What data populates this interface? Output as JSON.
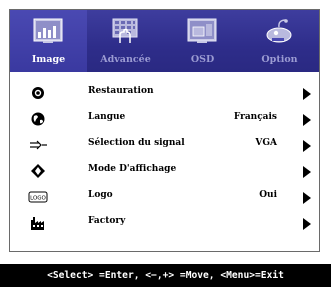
{
  "tabs": [
    {
      "label": "Image",
      "icon": "image-icon",
      "active": true
    },
    {
      "label": "Advancée",
      "icon": "advanced-icon",
      "active": false
    },
    {
      "label": "OSD",
      "icon": "osd-icon",
      "active": false
    },
    {
      "label": "Option",
      "icon": "option-icon",
      "active": false
    }
  ],
  "menu": {
    "items": [
      {
        "label": "Restauration",
        "value": "",
        "icon": "reset-icon"
      },
      {
        "label": "Langue",
        "value": "Français",
        "icon": "globe-icon"
      },
      {
        "label": "Sélection du signal",
        "value": "VGA",
        "icon": "input-signal-icon"
      },
      {
        "label": "Mode D'affichage",
        "value": "",
        "icon": "display-mode-icon"
      },
      {
        "label": "Logo",
        "value": "Oui",
        "icon": "logo-icon"
      },
      {
        "label": "Factory",
        "value": "",
        "icon": "factory-icon"
      }
    ]
  },
  "footer": {
    "hint": "<Select> =Enter, <−,+> =Move, <Menu>=Exit"
  },
  "colors": {
    "tabbar": "#2e2d8a",
    "active_tab_label": "#ffffff",
    "inactive_tab_label": "#9b9bd2",
    "footer_bg": "#000000",
    "footer_text": "#ffffff"
  },
  "logo_icon_text": "LOGO"
}
